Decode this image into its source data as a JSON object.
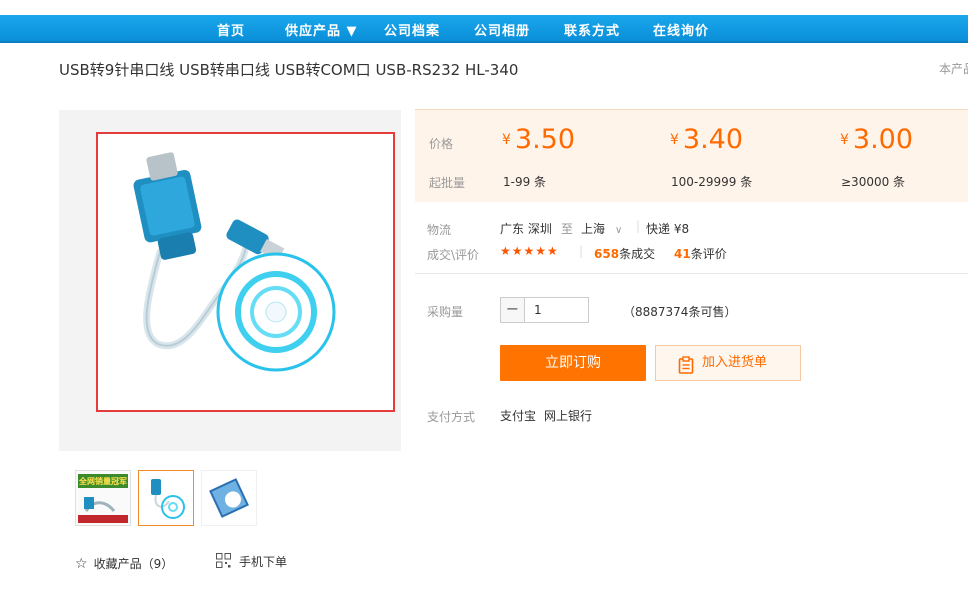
{
  "nav": {
    "items": [
      "首页",
      "供应产品 ▼",
      "公司档案",
      "公司相册",
      "联系方式",
      "在线询价"
    ]
  },
  "product": {
    "title": "USB转9针串口线 USB转串口线 USB转COM口 USB-RS232 HL-340",
    "side_note": "本产品"
  },
  "price_box": {
    "price_label": "价格",
    "min_qty_label": "起批量",
    "currency": "¥",
    "tiers": [
      {
        "price": "3.50",
        "range": "1-99 条"
      },
      {
        "price": "3.40",
        "range": "100-29999 条"
      },
      {
        "price": "3.00",
        "range": "≥30000 条"
      }
    ]
  },
  "logistics": {
    "label": "物流",
    "from": "广东 深圳",
    "to_word": "至",
    "to": "上海",
    "method": "快递 ¥8"
  },
  "reviews": {
    "label": "成交\\评价",
    "stars": "★★★★★",
    "deals_count": "658",
    "deals_suffix": "条成交",
    "reviews_count": "41",
    "reviews_suffix": "条评价"
  },
  "purchase": {
    "label": "采购量",
    "minus": "−",
    "quantity": "1",
    "available": "（8887374条可售）",
    "buy_now": "立即订购",
    "add_to_list": "加入进货单"
  },
  "payment": {
    "label": "支付方式",
    "methods": [
      "支付宝",
      "网上银行"
    ]
  },
  "actions": {
    "favorite": "收藏产品（9）",
    "mobile_order": "手机下单"
  },
  "thumbnails": {
    "banner_text": "全网销量冠军"
  },
  "colors": {
    "accent": "#ff6a00",
    "nav_blue": "#0a8fd8"
  }
}
